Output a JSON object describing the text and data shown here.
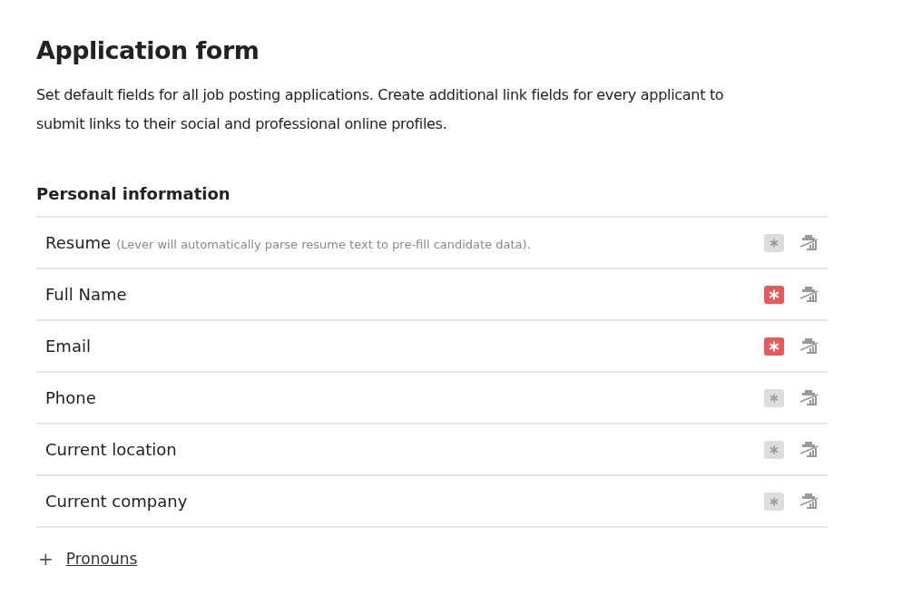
{
  "title": "Application form",
  "description": "Set default fields for all job posting applications. Create additional link fields for every applicant to submit links to their social and professional online profiles.",
  "section": {
    "title": "Personal information",
    "fields": [
      {
        "label": "Resume",
        "note": "(Lever will automatically parse resume text to pre-fill candidate data).",
        "required": false
      },
      {
        "label": "Full Name",
        "required": true
      },
      {
        "label": "Email",
        "required": true
      },
      {
        "label": "Phone",
        "required": false
      },
      {
        "label": "Current location",
        "required": false
      },
      {
        "label": "Current company",
        "required": false
      }
    ]
  },
  "add_button": {
    "icon": "+",
    "label": "Pronouns"
  }
}
